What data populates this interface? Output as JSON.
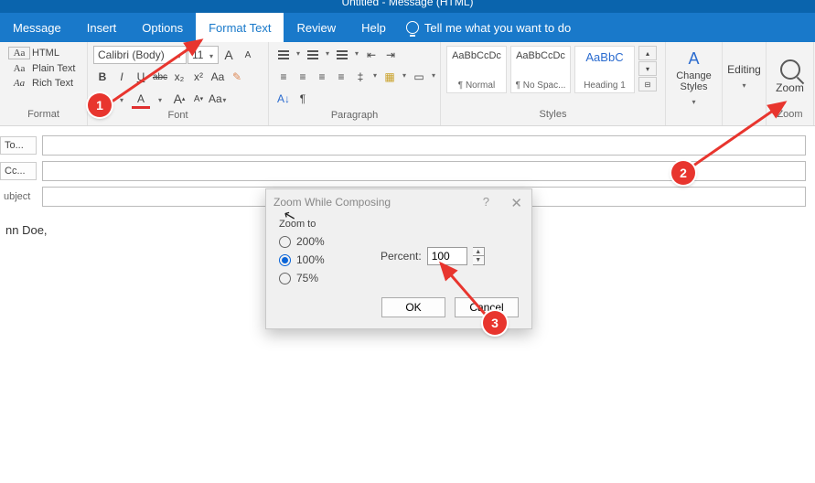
{
  "title": "Untitled  -  Message (HTML)",
  "menu": {
    "message": "Message",
    "insert": "Insert",
    "options": "Options",
    "format_text": "Format Text",
    "review": "Review",
    "help": "Help",
    "tell": "Tell me what you want to do"
  },
  "ribbon": {
    "format": {
      "label": "Format",
      "html": "HTML",
      "plain": "Plain Text",
      "rich": "Rich Text",
      "aa": "Aa"
    },
    "font": {
      "label": "Font",
      "name": "Calibri (Body)",
      "size": "11",
      "grow": "A",
      "shrink": "A",
      "case": "Aa",
      "clear": "A",
      "bold": "B",
      "italic": "I",
      "underline": "U",
      "strike": "abc",
      "sub": "x₂",
      "sup": "x²",
      "hilite": "A",
      "color": "A"
    },
    "para": {
      "label": "Paragraph"
    },
    "styles": {
      "label": "Styles",
      "s1": {
        "sample": "AaBbCcDc",
        "name": "¶ Normal"
      },
      "s2": {
        "sample": "AaBbCcDc",
        "name": "¶ No Spac..."
      },
      "s3": {
        "sample": "AaBbC",
        "name": "Heading 1"
      }
    },
    "change": {
      "label": "Change Styles",
      "text": "Change\nStyles"
    },
    "editing": {
      "label": "Editing"
    },
    "zoom": {
      "label": "Zoom",
      "text": "Zoom"
    }
  },
  "compose": {
    "to_label": "To...",
    "cc_label": "Cc...",
    "subject_label": "ubject",
    "to_value": "",
    "cc_value": "",
    "subject_value": "",
    "body": "nn Doe,"
  },
  "dialog": {
    "title": "Zoom While Composing",
    "section": "Zoom to",
    "opt_200": "200%",
    "opt_100": "100%",
    "opt_75": "75%",
    "percent_label": "Percent:",
    "percent_value": "100",
    "ok": "OK",
    "cancel": "Cancel"
  },
  "callouts": {
    "c1": "1",
    "c2": "2",
    "c3": "3"
  }
}
